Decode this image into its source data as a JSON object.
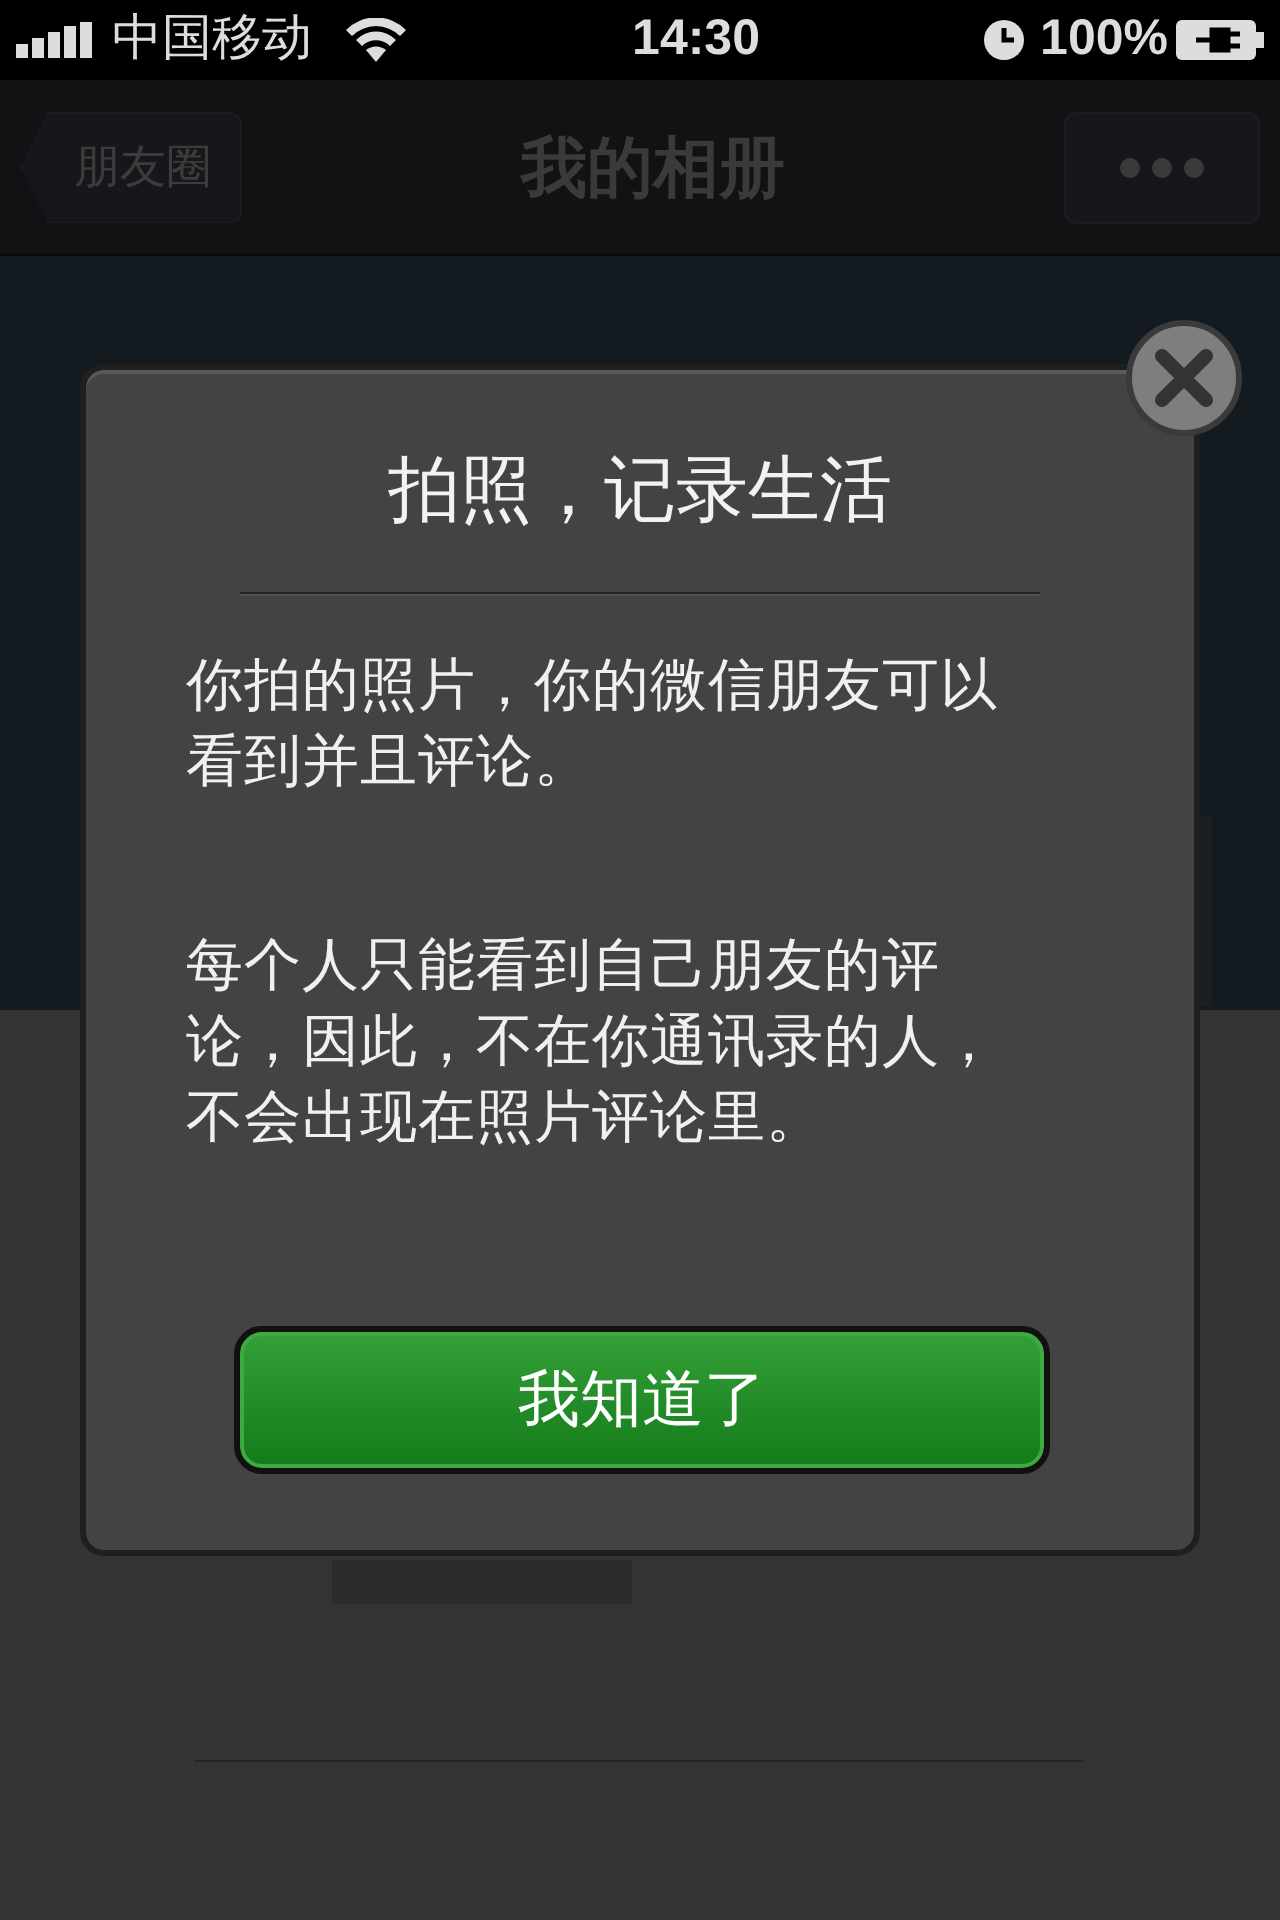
{
  "status_bar": {
    "carrier": "中国移动",
    "time": "14:30",
    "battery": "100%"
  },
  "nav": {
    "back": "朋友圈",
    "title": "我的相册"
  },
  "dialog": {
    "title": "拍照，记录生活",
    "paragraphs": [
      "你拍的照片，你的微信朋友可以看到并且评论。",
      "每个人只能看到自己朋友的评论，因此，不在你通讯录的人，不会出现在照片评论里。"
    ],
    "button": "我知道了"
  }
}
